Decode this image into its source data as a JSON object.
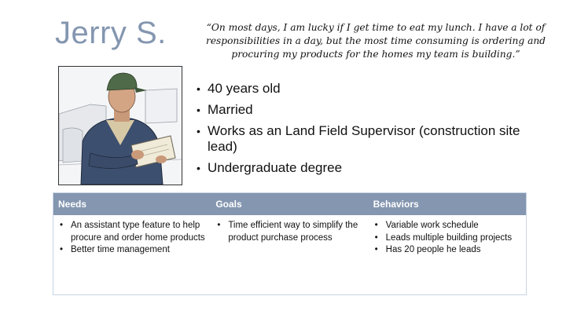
{
  "persona": {
    "name": "Jerry S.",
    "quote": "“On most days, I am lucky if I get time to eat my lunch.  I have a lot of responsibilities in a day, but the most time consuming is ordering and procuring my products for the homes my team is building.”",
    "facts": [
      "40 years old",
      "Married",
      "Works as an Land Field Supervisor (construction site lead)",
      "Undergraduate degree"
    ]
  },
  "table": {
    "headers": [
      "Needs",
      "Goals",
      "Behaviors"
    ],
    "needs": [
      "An assistant type feature to help procure and order home products",
      "Better time management"
    ],
    "goals": [
      "Time efficient way to simplify the product purchase process"
    ],
    "behaviors": [
      "Variable work schedule",
      "Leads multiple building projects",
      "Has 20 people he leads"
    ]
  },
  "colors": {
    "accent": "#8496b0",
    "border": "#c8d4e3"
  }
}
